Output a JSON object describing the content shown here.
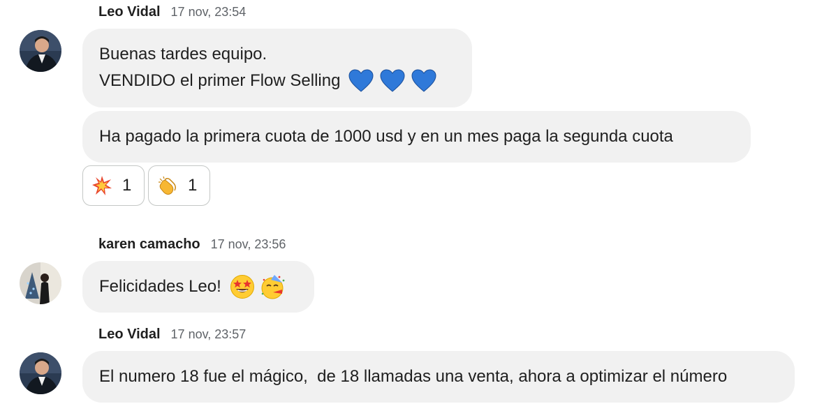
{
  "messages": [
    {
      "sender": "Leo Vidal",
      "time": "17 nov, 23:54",
      "bubbles": [
        {
          "line1": "Buenas tardes equipo.",
          "line2": "VENDIDO el primer Flow Selling",
          "emojis": [
            "blue-heart",
            "blue-heart",
            "blue-heart"
          ]
        },
        {
          "text": "Ha pagado la primera cuota de 1000 usd y en un mes paga la segunda cuota"
        }
      ],
      "reactions": [
        {
          "emoji": "collision",
          "count": "1"
        },
        {
          "emoji": "clapping-hands",
          "count": "1"
        }
      ]
    },
    {
      "sender": "karen camacho",
      "time": "17 nov, 23:56",
      "text": "Felicidades Leo!",
      "emojis": [
        "star-struck",
        "partying-face"
      ]
    },
    {
      "sender": "Leo Vidal",
      "time": "17 nov, 23:57",
      "text": "El numero 18 fue el mágico,  de 18 llamadas una venta, ahora a optimizar el número"
    }
  ],
  "colors": {
    "bubble": "#f1f1f1",
    "timestamp": "#5f6368",
    "chip_border": "#c4c7c5",
    "heart": "#2f79d9"
  }
}
